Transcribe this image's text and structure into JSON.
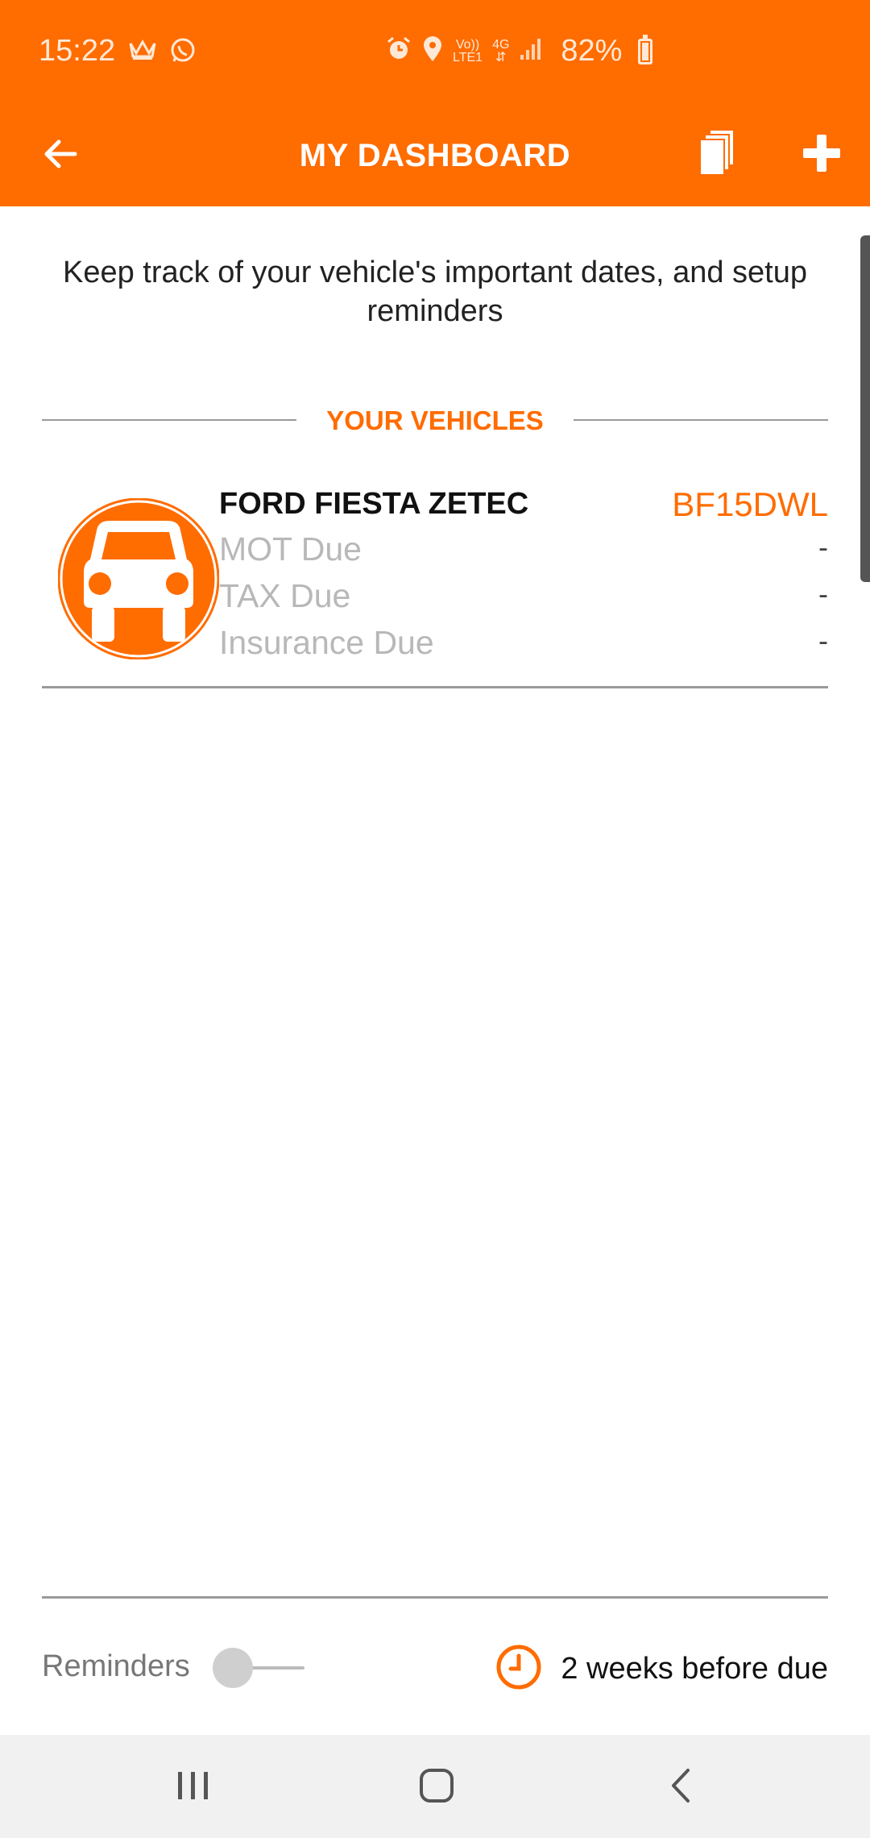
{
  "status_bar": {
    "time": "15:22",
    "network": {
      "volte": "Vo))",
      "lte": "LTE1",
      "gen": "4G"
    },
    "battery": "82%",
    "icons": [
      "crown-icon",
      "whatsapp-icon",
      "alarm-icon",
      "location-icon",
      "signal-icon",
      "battery-icon"
    ]
  },
  "app_bar": {
    "title": "MY DASHBOARD",
    "icons": [
      "arrow-left-icon",
      "documents-icon",
      "plus-icon"
    ]
  },
  "main": {
    "intro": "Keep track of your vehicle's important dates, and setup reminders",
    "section_title": "YOUR VEHICLES",
    "vehicles": [
      {
        "name": "FORD FIESTA ZETEC",
        "plate": "BF15DWL",
        "dues": [
          {
            "label": "MOT Due",
            "value": "-"
          },
          {
            "label": "TAX Due",
            "value": "-"
          },
          {
            "label": "Insurance Due",
            "value": "-"
          }
        ]
      }
    ]
  },
  "footer": {
    "reminders_label": "Reminders",
    "reminders_on": false,
    "timing": "2 weeks before due"
  },
  "colors": {
    "accent": "#ff6c00",
    "muted_text": "#b8b8b8",
    "divider": "#9a9a9a"
  },
  "nav_bar": {
    "icons": [
      "recent-apps-icon",
      "home-icon",
      "back-icon"
    ]
  }
}
